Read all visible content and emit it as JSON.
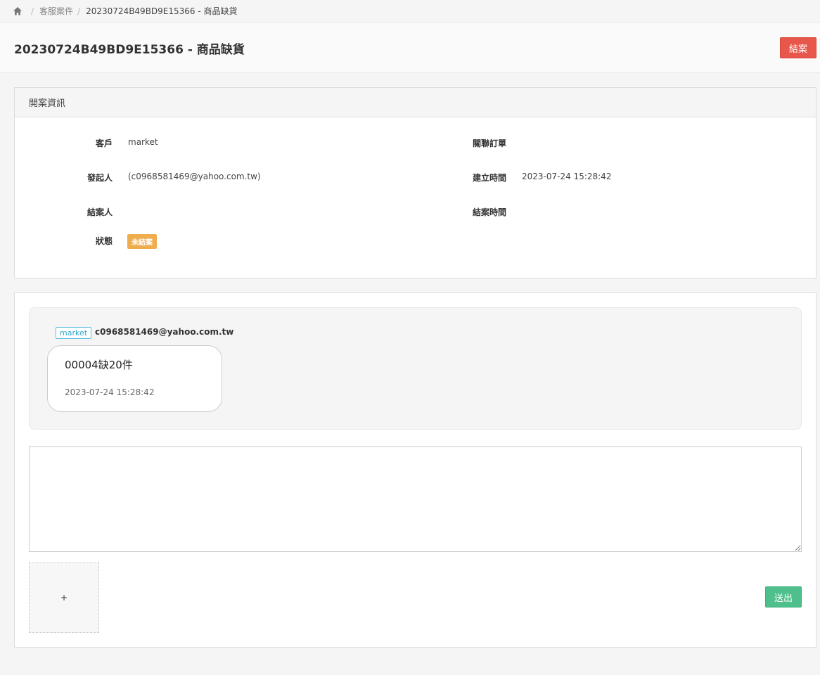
{
  "breadcrumb": {
    "home_icon": "home-icon",
    "items": [
      "客服案件",
      "20230724B49BD9E15366 - 商品缺貨"
    ]
  },
  "header": {
    "title": "20230724B49BD9E15366 - 商品缺貨",
    "close_case_label": "結案"
  },
  "info": {
    "panel_title": "開案資訊",
    "customer_label": "客戶",
    "customer_value": "market",
    "related_order_label": "關聯訂單",
    "related_order_value": "",
    "initiator_label": "發起人",
    "initiator_value": "(c0968581469@yahoo.com.tw)",
    "created_time_label": "建立時間",
    "created_time_value": "2023-07-24 15:28:42",
    "closer_label": "結案人",
    "closer_value": "",
    "closed_time_label": "結案時間",
    "closed_time_value": "",
    "status_label": "狀態",
    "status_value": "未結案",
    "status_color": "#f0ad4e"
  },
  "conversation": {
    "messages": [
      {
        "sender_tag": "market",
        "sender_email": "c0968581469@yahoo.com.tw",
        "text": "00004缺20件",
        "time": "2023-07-24 15:28:42"
      }
    ],
    "reply_value": "",
    "upload_label": "+",
    "send_label": "送出"
  },
  "colors": {
    "danger": "#e8574b",
    "success": "#4fc08d",
    "warning": "#f0ad4e",
    "info": "#5bc0de"
  }
}
